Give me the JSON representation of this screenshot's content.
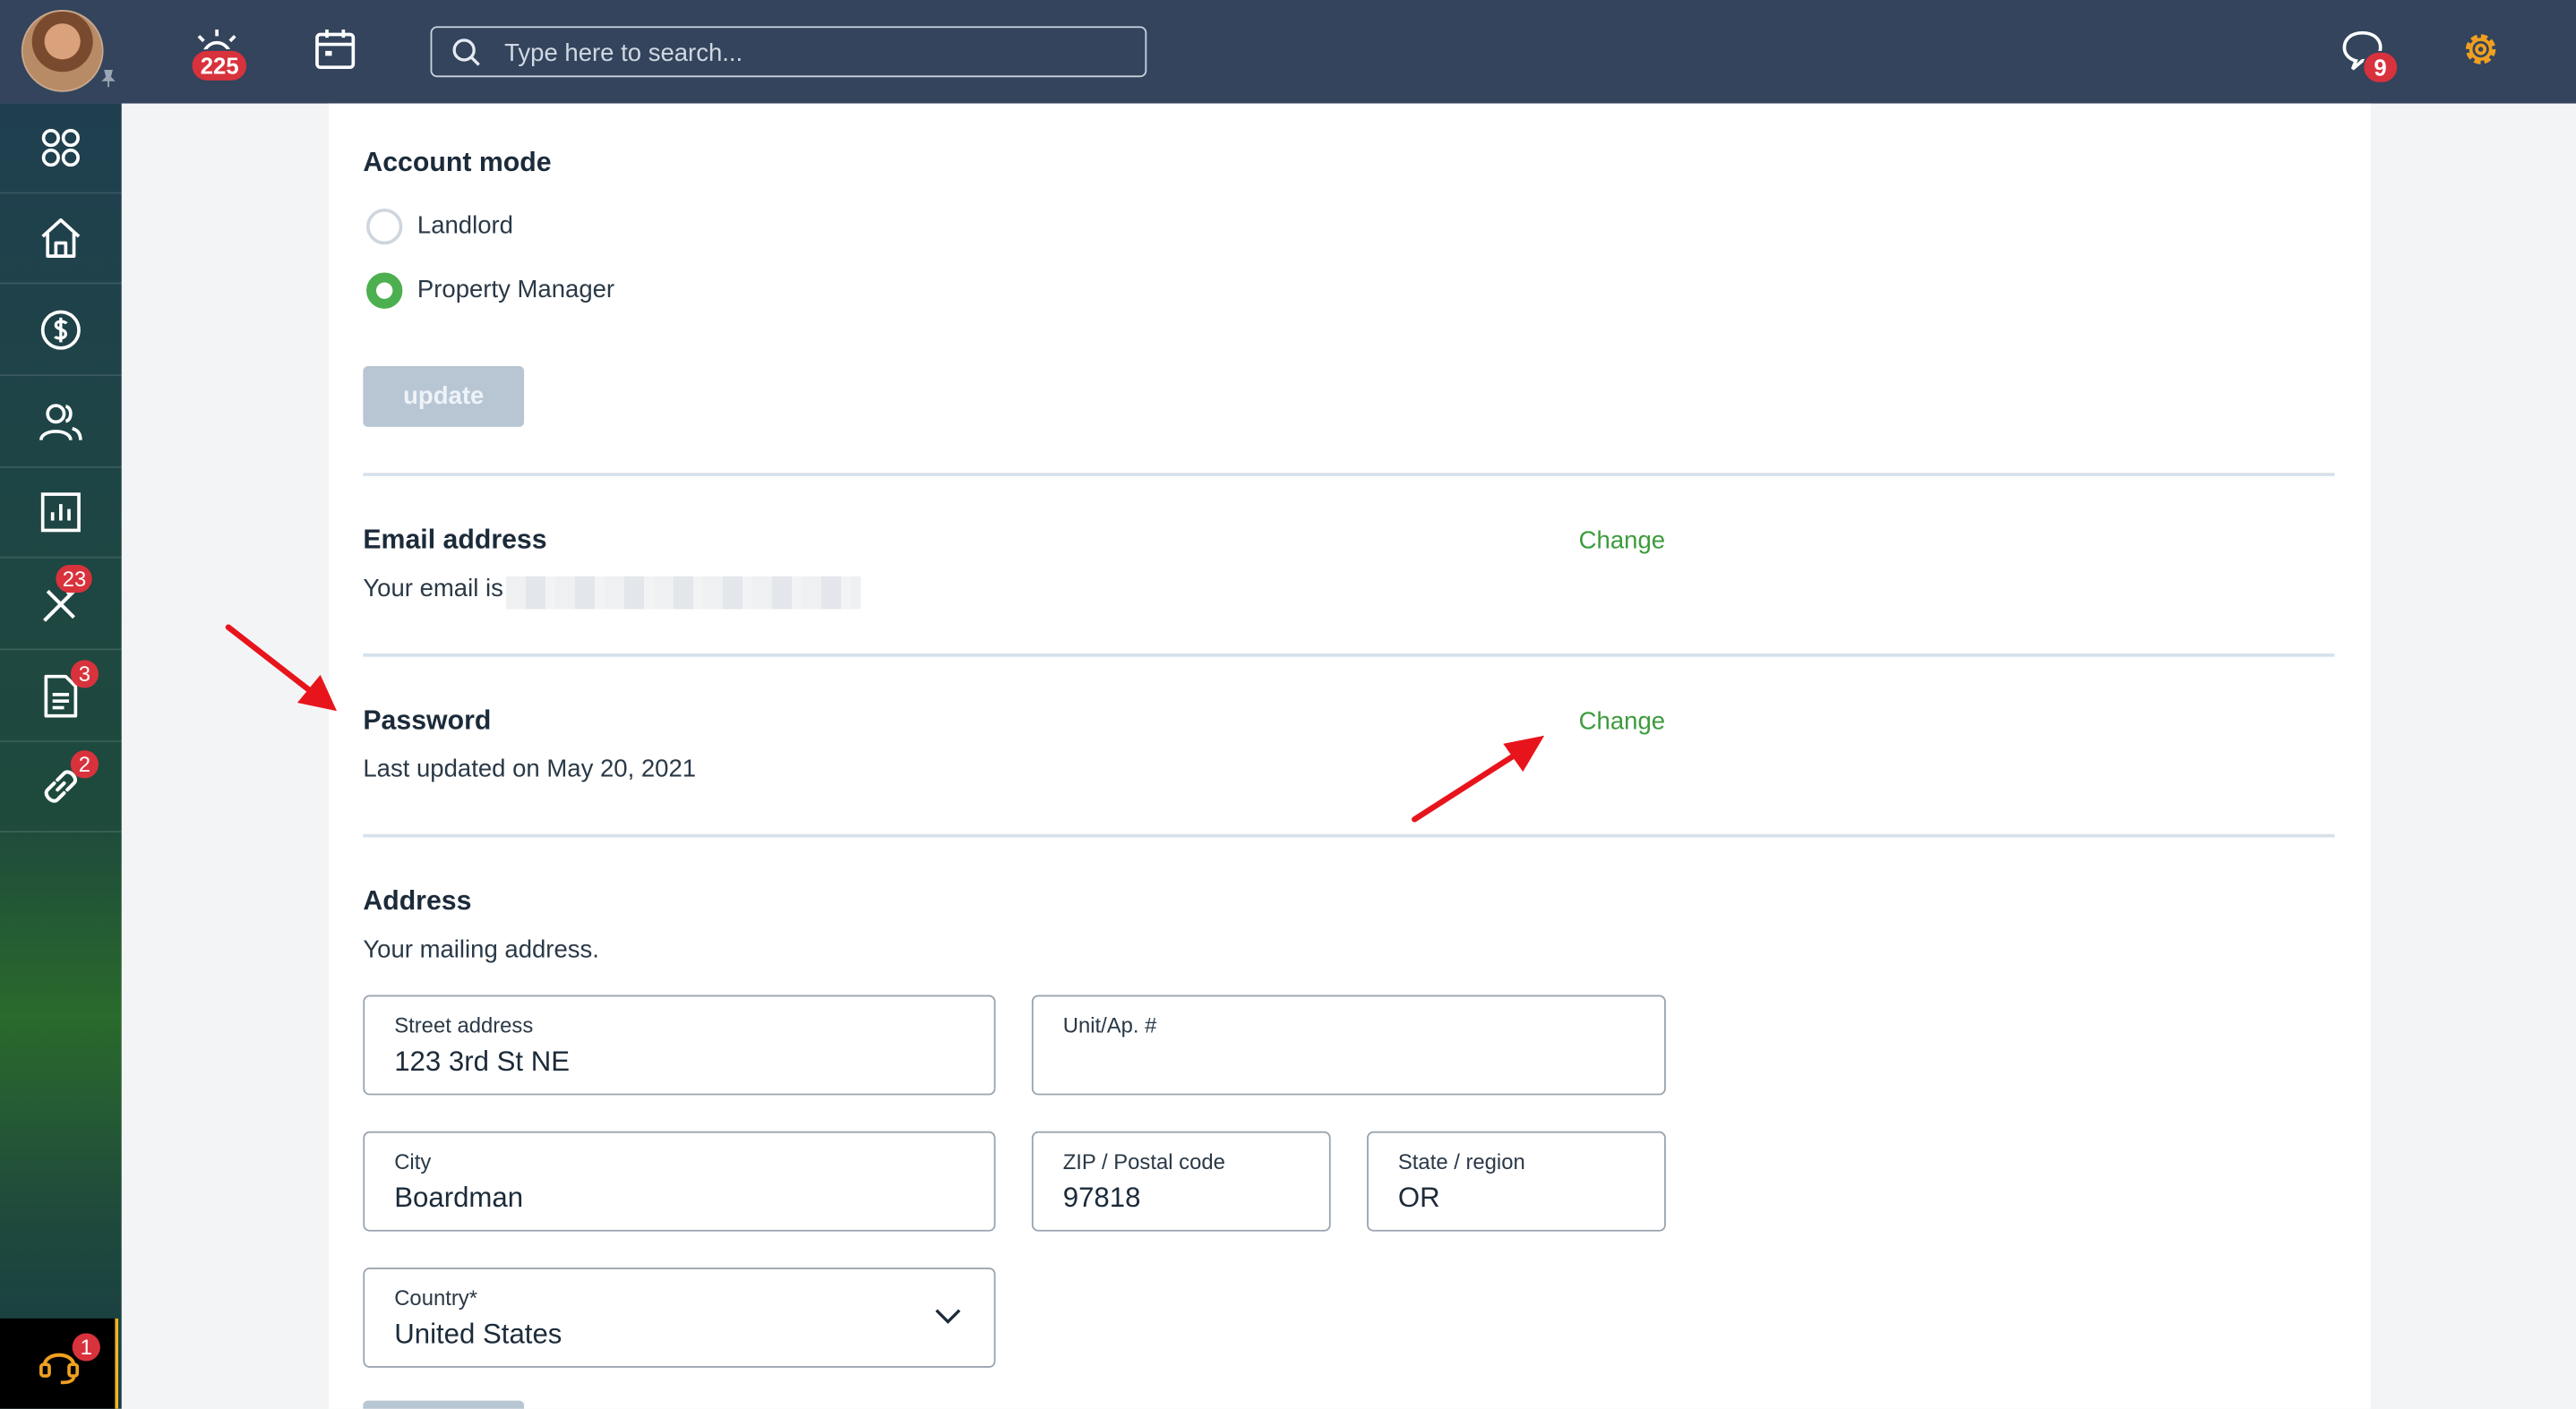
{
  "topbar": {
    "alerts_count": "225",
    "messages_count": "9",
    "search_placeholder": "Type here to search...",
    "accent_color": "#f0a020"
  },
  "sidebar": {
    "items": [
      {
        "icon": "apps-grid-icon"
      },
      {
        "icon": "home-icon"
      },
      {
        "icon": "dollar-icon"
      },
      {
        "icon": "people-icon"
      },
      {
        "icon": "reports-chart-icon"
      },
      {
        "icon": "tools-icon",
        "badge": "23"
      },
      {
        "icon": "document-icon",
        "badge": "3"
      },
      {
        "icon": "link-icon",
        "badge": "2"
      }
    ],
    "support_badge": "1"
  },
  "account_mode": {
    "title": "Account mode",
    "options": [
      {
        "label": "Landlord",
        "selected": false
      },
      {
        "label": "Property Manager",
        "selected": true
      }
    ],
    "update_label": "update"
  },
  "email": {
    "title": "Email address",
    "description": "Your email is",
    "change_label": "Change"
  },
  "password": {
    "title": "Password",
    "description": "Last updated on May 20, 2021",
    "change_label": "Change"
  },
  "address": {
    "title": "Address",
    "description": "Your mailing address.",
    "street": {
      "label": "Street address",
      "value": "123 3rd St NE"
    },
    "unit": {
      "label": "Unit/Ap. #",
      "value": ""
    },
    "city": {
      "label": "City",
      "value": "Boardman"
    },
    "zip": {
      "label": "ZIP / Postal code",
      "value": "97818"
    },
    "state": {
      "label": "State / region",
      "value": "OR"
    },
    "country": {
      "label": "Country*",
      "value": "United States"
    }
  },
  "colors": {
    "topbar": "#33445c",
    "success": "#4caf50",
    "link": "#3c9b3c",
    "badge": "#d8323c",
    "annotation_arrow": "#e8141c"
  }
}
